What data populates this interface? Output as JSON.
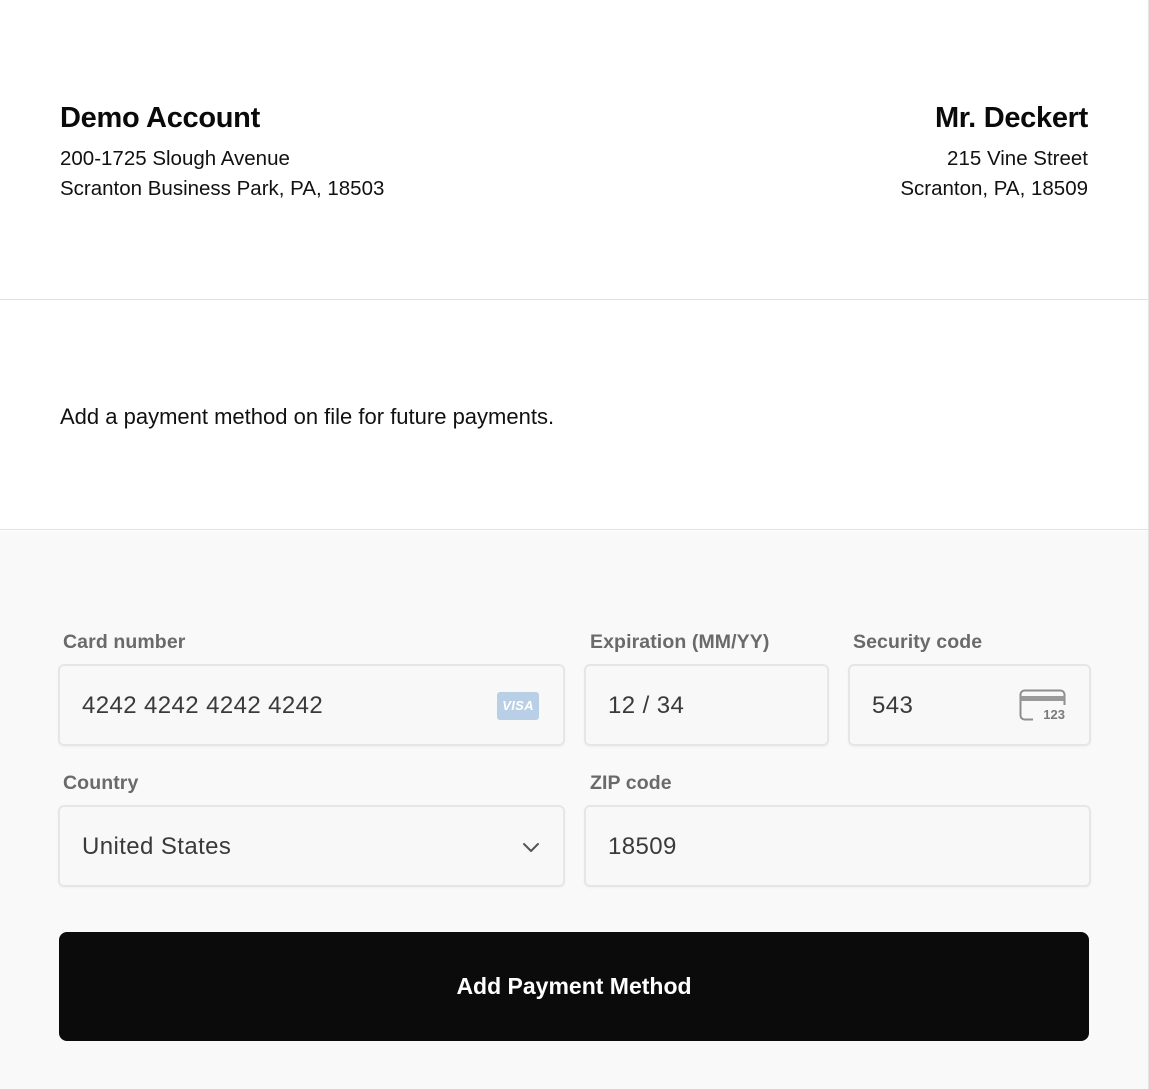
{
  "from": {
    "name": "Demo Account",
    "address_line1": "200-1725 Slough Avenue",
    "address_line2": "Scranton Business Park, PA, 18503"
  },
  "to": {
    "name": "Mr. Deckert",
    "address_line1": "215 Vine Street",
    "address_line2": "Scranton, PA, 18509"
  },
  "description": "Add a payment method on file for future payments.",
  "form": {
    "card_number": {
      "label": "Card number",
      "value": "4242 4242 4242 4242",
      "brand_icon": "visa-icon",
      "brand_text": "VISA"
    },
    "expiration": {
      "label": "Expiration (MM/YY)",
      "value": "12 / 34"
    },
    "security_code": {
      "label": "Security code",
      "value": "543",
      "icon": "card-cvc-icon",
      "icon_text": "123"
    },
    "country": {
      "label": "Country",
      "value": "United States",
      "icon": "chevron-down-icon"
    },
    "zip": {
      "label": "ZIP code",
      "value": "18509"
    },
    "submit_label": "Add Payment Method"
  },
  "colors": {
    "button_bg": "#0b0b0b",
    "form_bg": "#f9f9f9",
    "label": "#6a6a6a",
    "visa_badge": "#b9cfe6"
  }
}
